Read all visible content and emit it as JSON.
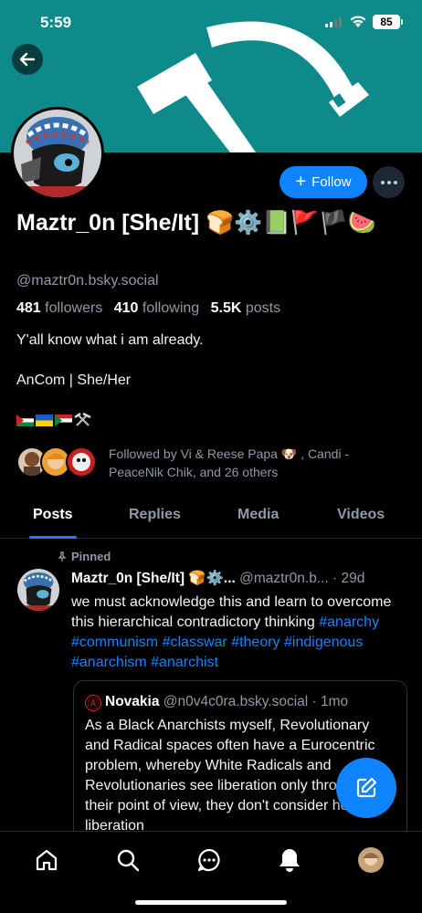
{
  "status_bar": {
    "time": "5:59",
    "battery": "85"
  },
  "profile": {
    "display_name": "Maztr_0n [She/It] 🍞⚙️📗🚩🏴🍉",
    "handle": "@maztr0n.bsky.social",
    "followers_count": "481",
    "followers_label": "followers",
    "following_count": "410",
    "following_label": "following",
    "posts_count": "5.5K",
    "posts_label": "posts",
    "bio_line1": "Y'all know what i am already.",
    "bio_line2": "AnCom | She/Her",
    "followed_by": "Followed by Vi & Reese Papa 🐶 , Candi - PeaceNik Chik, and 26 others"
  },
  "actions": {
    "follow_label": "Follow"
  },
  "tabs": [
    {
      "label": "Posts",
      "active": true
    },
    {
      "label": "Replies",
      "active": false
    },
    {
      "label": "Media",
      "active": false
    },
    {
      "label": "Videos",
      "active": false
    }
  ],
  "post": {
    "pinned_label": "Pinned",
    "author_name": "Maztr_0n [She/It] 🍞⚙️...",
    "author_meta": "@maztr0n.b... · 29d",
    "text": "we must acknowledge this and learn to overcome this hierarchical contradictory thinking",
    "hashtags": [
      "#anarchy",
      "#communism",
      "#classwar",
      "#theory",
      "#indigenous",
      "#anarchism",
      "#anarchist"
    ],
    "quote": {
      "author_name": "Novakia",
      "author_meta": "@n0v4c0ra.bsky.social · 1mo",
      "text": "As a Black Anarchists myself, Revolutionary and Radical spaces often have a Eurocentric problem, whereby White Radicals and Revolutionaries see liberation only through their point of view, they don't consider how liberation"
    }
  },
  "colors": {
    "accent": "#1083fe",
    "banner": "#0f8a8a",
    "muted": "#8e9aa8",
    "background": "#000000"
  }
}
